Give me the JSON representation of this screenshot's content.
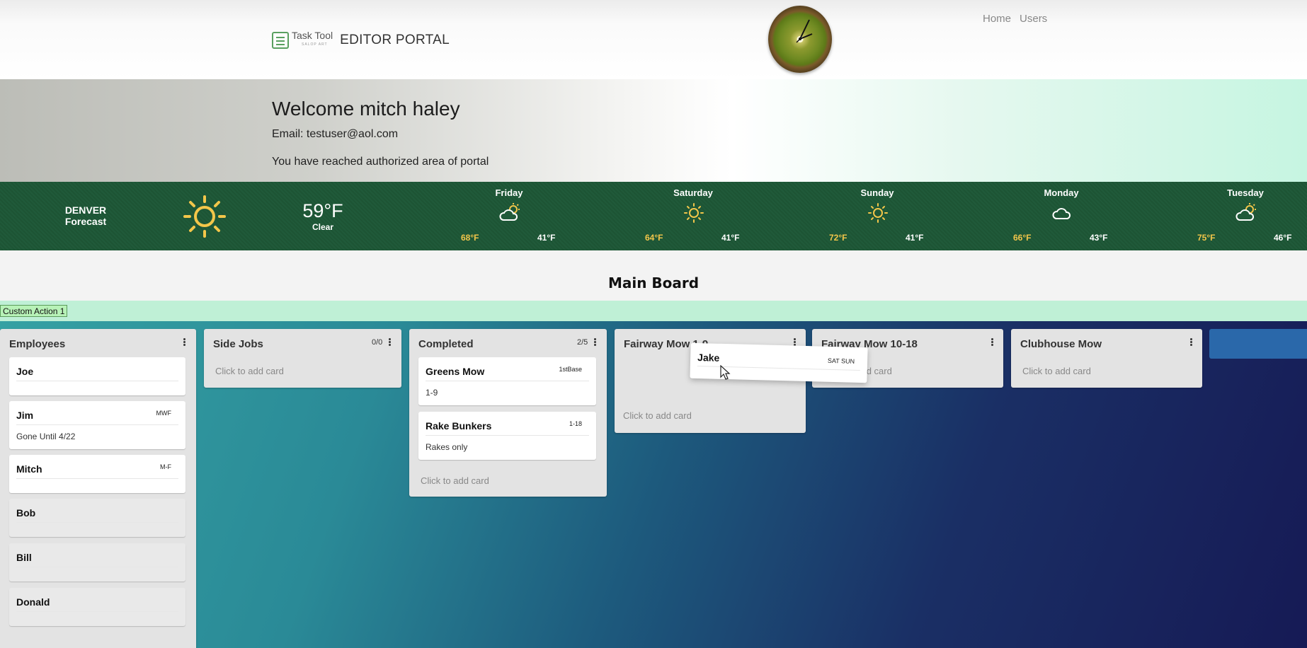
{
  "nav": {
    "brand_name": "Task Tool",
    "brand_sub": "SALOP ART",
    "portal_title": "EDITOR PORTAL",
    "links": [
      "Home",
      "Users"
    ]
  },
  "welcome": {
    "title": "Welcome mitch haley",
    "email": "Email: testuser@aol.com",
    "message": "You have reached authorized area of portal"
  },
  "weather": {
    "city": "DENVER",
    "label": "Forecast",
    "current_icon": "sun-icon",
    "current_temp": "59°F",
    "current_cond": "Clear",
    "days": [
      {
        "name": "Friday",
        "icon": "partly-cloudy-icon",
        "hi": "68°F",
        "lo": "41°F"
      },
      {
        "name": "Saturday",
        "icon": "sun-icon",
        "hi": "64°F",
        "lo": "41°F"
      },
      {
        "name": "Sunday",
        "icon": "sun-icon",
        "hi": "72°F",
        "lo": "41°F"
      },
      {
        "name": "Monday",
        "icon": "cloud-icon",
        "hi": "66°F",
        "lo": "43°F"
      },
      {
        "name": "Tuesday",
        "icon": "partly-cloudy-icon",
        "hi": "75°F",
        "lo": "46°F"
      }
    ],
    "colors": {
      "hi": "#f3c64a",
      "lo": "#ffffff",
      "band": "#205a3a"
    }
  },
  "board": {
    "title": "Main Board",
    "custom_action": "Custom Action 1",
    "add_card": "Click to add card",
    "lanes": [
      {
        "title": "Employees",
        "cards": [
          {
            "title": "Joe",
            "tag": "",
            "desc": ""
          },
          {
            "title": "Jim",
            "tag": "MWF",
            "desc": "Gone Until 4/22"
          },
          {
            "title": "Mitch",
            "tag": "M-F",
            "desc": ""
          },
          {
            "title": "Bob",
            "tag": "",
            "desc": ""
          },
          {
            "title": "Bill",
            "tag": "",
            "desc": ""
          },
          {
            "title": "Donald",
            "tag": "",
            "desc": ""
          }
        ]
      },
      {
        "title": "Side Jobs",
        "count": "0/0",
        "cards": []
      },
      {
        "title": "Completed",
        "count": "2/5",
        "cards": [
          {
            "title": "Greens Mow",
            "tag": "1stBase",
            "desc": "1-9"
          },
          {
            "title": "Rake Bunkers",
            "tag": "1-18",
            "desc": "Rakes only"
          }
        ]
      },
      {
        "title": "Fairway Mow 1-9",
        "cards": []
      },
      {
        "title": "Fairway Mow 10-18",
        "cards": []
      },
      {
        "title": "Clubhouse Mow",
        "cards": []
      }
    ],
    "dragging_card": {
      "title": "Jake",
      "tag": "SAT SUN"
    },
    "colors": {
      "lane": "#e3e3e3",
      "board_start": "#35a1a3",
      "board_end": "#161a55"
    }
  }
}
